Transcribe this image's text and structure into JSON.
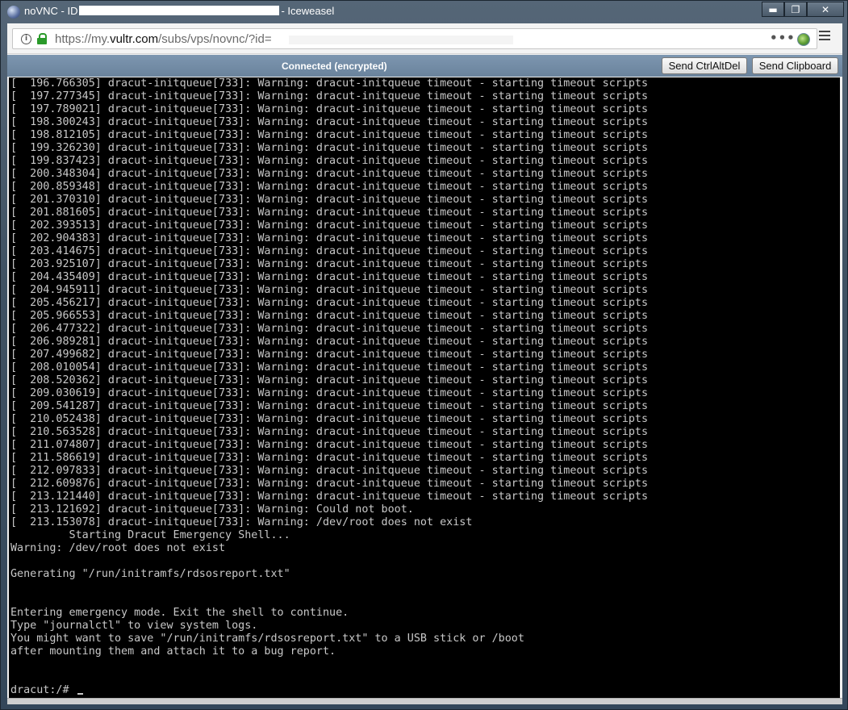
{
  "window": {
    "title_prefix": "noVNC - ID",
    "title_suffix": "- Iceweasel",
    "minimize_label": "▬",
    "maximize_label": "❐",
    "close_label": "✕"
  },
  "browser": {
    "url_prefix": "https://my.",
    "url_domain": "vultr.com",
    "url_path": "/subs/vps/novnc/?id=",
    "more_label": "•••"
  },
  "novnc": {
    "status": "Connected (encrypted)",
    "ctrl_alt_del_label": "Send CtrlAltDel",
    "clipboard_label": "Send Clipboard"
  },
  "terminal": {
    "lines": [
      "[  196.766305] dracut-initqueue[733]: Warning: dracut-initqueue timeout - starting timeout scripts",
      "[  197.277345] dracut-initqueue[733]: Warning: dracut-initqueue timeout - starting timeout scripts",
      "[  197.789021] dracut-initqueue[733]: Warning: dracut-initqueue timeout - starting timeout scripts",
      "[  198.300243] dracut-initqueue[733]: Warning: dracut-initqueue timeout - starting timeout scripts",
      "[  198.812105] dracut-initqueue[733]: Warning: dracut-initqueue timeout - starting timeout scripts",
      "[  199.326230] dracut-initqueue[733]: Warning: dracut-initqueue timeout - starting timeout scripts",
      "[  199.837423] dracut-initqueue[733]: Warning: dracut-initqueue timeout - starting timeout scripts",
      "[  200.348304] dracut-initqueue[733]: Warning: dracut-initqueue timeout - starting timeout scripts",
      "[  200.859348] dracut-initqueue[733]: Warning: dracut-initqueue timeout - starting timeout scripts",
      "[  201.370310] dracut-initqueue[733]: Warning: dracut-initqueue timeout - starting timeout scripts",
      "[  201.881605] dracut-initqueue[733]: Warning: dracut-initqueue timeout - starting timeout scripts",
      "[  202.393513] dracut-initqueue[733]: Warning: dracut-initqueue timeout - starting timeout scripts",
      "[  202.904383] dracut-initqueue[733]: Warning: dracut-initqueue timeout - starting timeout scripts",
      "[  203.414675] dracut-initqueue[733]: Warning: dracut-initqueue timeout - starting timeout scripts",
      "[  203.925107] dracut-initqueue[733]: Warning: dracut-initqueue timeout - starting timeout scripts",
      "[  204.435409] dracut-initqueue[733]: Warning: dracut-initqueue timeout - starting timeout scripts",
      "[  204.945911] dracut-initqueue[733]: Warning: dracut-initqueue timeout - starting timeout scripts",
      "[  205.456217] dracut-initqueue[733]: Warning: dracut-initqueue timeout - starting timeout scripts",
      "[  205.966553] dracut-initqueue[733]: Warning: dracut-initqueue timeout - starting timeout scripts",
      "[  206.477322] dracut-initqueue[733]: Warning: dracut-initqueue timeout - starting timeout scripts",
      "[  206.989281] dracut-initqueue[733]: Warning: dracut-initqueue timeout - starting timeout scripts",
      "[  207.499682] dracut-initqueue[733]: Warning: dracut-initqueue timeout - starting timeout scripts",
      "[  208.010054] dracut-initqueue[733]: Warning: dracut-initqueue timeout - starting timeout scripts",
      "[  208.520362] dracut-initqueue[733]: Warning: dracut-initqueue timeout - starting timeout scripts",
      "[  209.030619] dracut-initqueue[733]: Warning: dracut-initqueue timeout - starting timeout scripts",
      "[  209.541287] dracut-initqueue[733]: Warning: dracut-initqueue timeout - starting timeout scripts",
      "[  210.052438] dracut-initqueue[733]: Warning: dracut-initqueue timeout - starting timeout scripts",
      "[  210.563528] dracut-initqueue[733]: Warning: dracut-initqueue timeout - starting timeout scripts",
      "[  211.074807] dracut-initqueue[733]: Warning: dracut-initqueue timeout - starting timeout scripts",
      "[  211.586619] dracut-initqueue[733]: Warning: dracut-initqueue timeout - starting timeout scripts",
      "[  212.097833] dracut-initqueue[733]: Warning: dracut-initqueue timeout - starting timeout scripts",
      "[  212.609876] dracut-initqueue[733]: Warning: dracut-initqueue timeout - starting timeout scripts",
      "[  213.121440] dracut-initqueue[733]: Warning: dracut-initqueue timeout - starting timeout scripts",
      "[  213.121692] dracut-initqueue[733]: Warning: Could not boot.",
      "[  213.153078] dracut-initqueue[733]: Warning: /dev/root does not exist",
      "         Starting Dracut Emergency Shell...",
      "Warning: /dev/root does not exist",
      "",
      "Generating \"/run/initramfs/rdsosreport.txt\"",
      "",
      "",
      "Entering emergency mode. Exit the shell to continue.",
      "Type \"journalctl\" to view system logs.",
      "You might want to save \"/run/initramfs/rdsosreport.txt\" to a USB stick or /boot",
      "after mounting them and attach it to a bug report.",
      "",
      "",
      "dracut:/# "
    ]
  }
}
